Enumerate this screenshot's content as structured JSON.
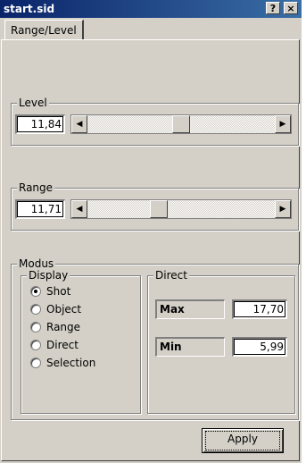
{
  "window": {
    "title": "start.sid",
    "help_label": "?",
    "close_label": "×"
  },
  "tabs": [
    {
      "label": "Range/Level"
    }
  ],
  "level": {
    "label": "Level",
    "value": "11,84",
    "slider_fraction": 0.5
  },
  "range": {
    "label": "Range",
    "value": "11,71",
    "slider_fraction": 0.37
  },
  "modus": {
    "label": "Modus",
    "display": {
      "label": "Display",
      "options": [
        {
          "label": "Shot",
          "selected": true
        },
        {
          "label": "Object",
          "selected": false
        },
        {
          "label": "Range",
          "selected": false
        },
        {
          "label": "Direct",
          "selected": false
        },
        {
          "label": "Selection",
          "selected": false
        }
      ]
    },
    "direct": {
      "label": "Direct",
      "max_label": "Max",
      "max_value": "17,70",
      "min_label": "Min",
      "min_value": "5,99"
    }
  },
  "apply_label": "Apply",
  "icons": {
    "scroll_left": "arrow-left-icon",
    "scroll_right": "arrow-right-icon"
  }
}
